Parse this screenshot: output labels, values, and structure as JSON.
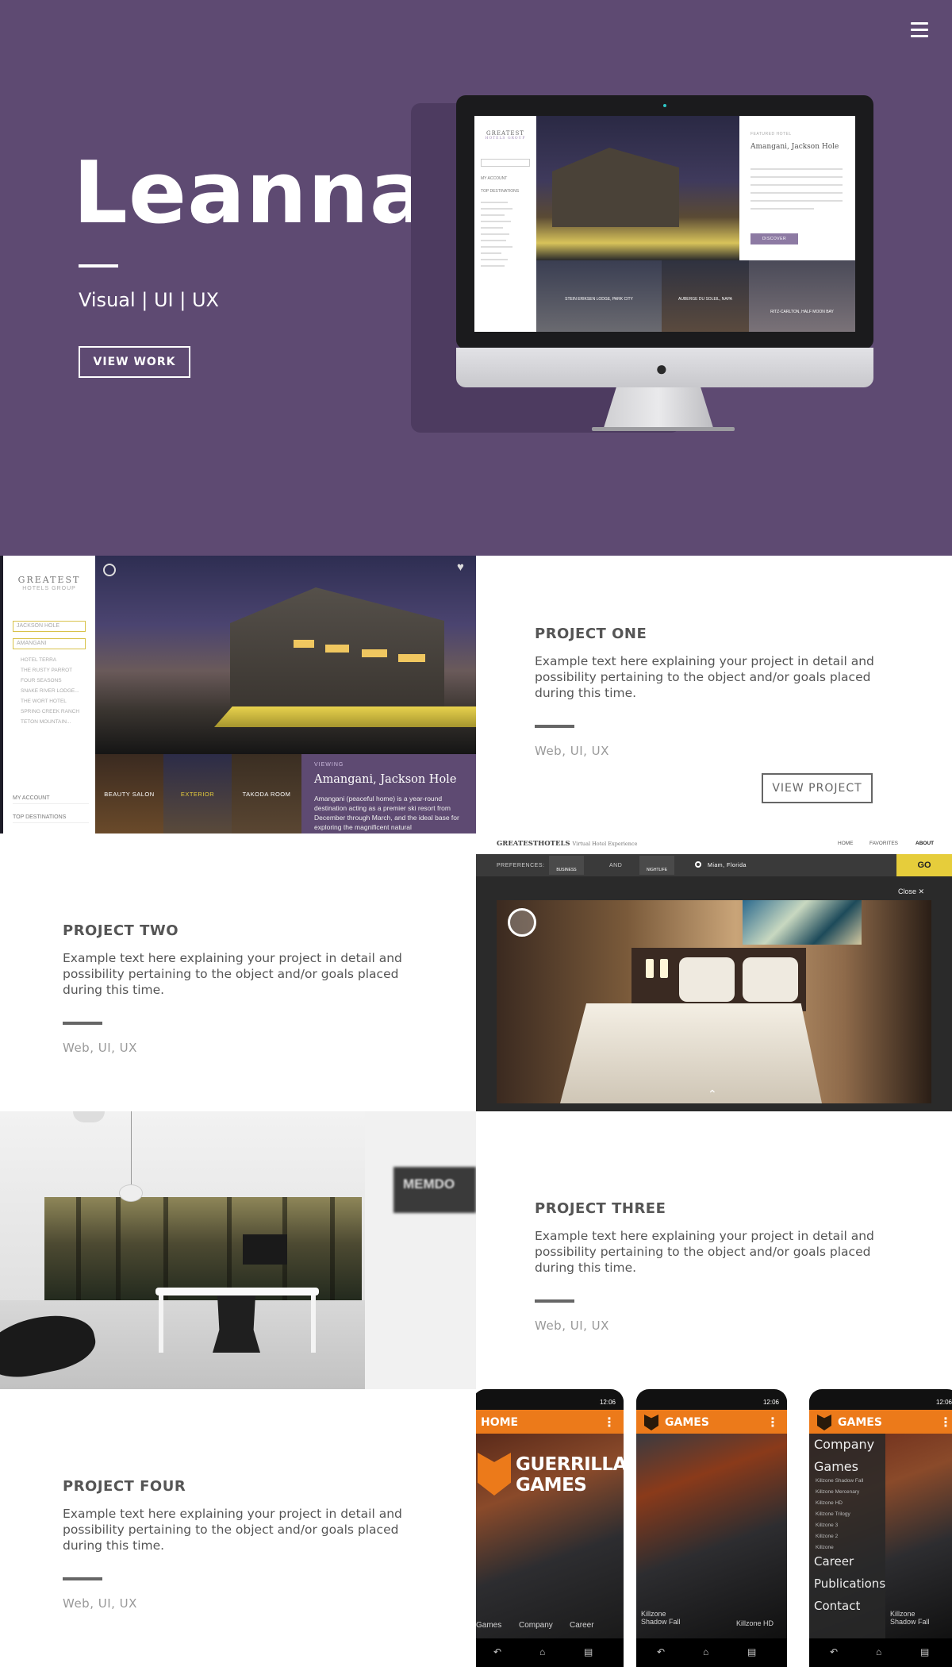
{
  "hero": {
    "title": "Leanna.",
    "subtitle": "Visual | UI | UX",
    "cta_label": "VIEW WORK",
    "menu_icon": "hamburger-menu-icon",
    "background_color": "#5e4a72"
  },
  "hero_mockup": {
    "brand_top": "GREATEST",
    "brand_bottom": "HOTELS GROUP",
    "featured_label": "FEATURED HOTEL",
    "featured_title": "Amangani, Jackson Hole",
    "discover_label": "DISCOVER",
    "sidebar_labels": [
      "MY ACCOUNT",
      "TOP DESTINATIONS"
    ],
    "thumbs": [
      "STEIN ERIKSEN LODGE, PARK CITY",
      "AUBERGE DU SOLEIL, NAPA",
      "RITZ-CARLTON, HALF MOON BAY"
    ]
  },
  "projects": [
    {
      "title": "PROJECT ONE",
      "description": "Example text here explaining your project in detail and possibility pertaining to the object and/or goals placed during this time.",
      "tags": "Web, UI, UX",
      "button_label": "VIEW PROJECT"
    },
    {
      "title": "PROJECT TWO",
      "description": "Example text here explaining your project in detail and possibility pertaining to the object and/or goals placed during this time.",
      "tags": "Web, UI, UX"
    },
    {
      "title": "PROJECT THREE",
      "description": "Example text here explaining your project in detail and possibility pertaining to the object and/or goals placed during this time.",
      "tags": "Web, UI, UX"
    },
    {
      "title": "PROJECT FOUR",
      "description": "Example text here explaining your project in detail and possibility pertaining to the object and/or goals placed during this time.",
      "tags": "Web, UI, UX"
    }
  ],
  "project_one_mockup": {
    "brand_top": "GREATEST",
    "brand_bottom": "HOTELS GROUP",
    "search_values": [
      "JACKSON HOLE",
      "AMANGANI"
    ],
    "hotel_list": [
      "HOTEL TERRA",
      "THE RUSTY PARROT",
      "FOUR SEASONS",
      "SNAKE RIVER LODGE...",
      "THE WORT HOTEL",
      "SPRING CREEK RANCH",
      "TETON MOUNTAIN..."
    ],
    "nav": [
      "MY ACCOUNT",
      "TOP DESTINATIONS"
    ],
    "thumbs": [
      "BEAUTY SALON",
      "EXTERIOR",
      "TAKODA ROOM"
    ],
    "viewing_label": "VIEWING",
    "hotel_name": "Amangani, Jackson Hole",
    "hotel_blurb": "Amangani (peaceful home) is a year-round destination acting as a premier ski resort from December through March, and the ideal base for exploring the magnificent natural"
  },
  "project_two_mockup": {
    "brand": "GREATESTHOTELS",
    "tagline": "Virtual Hotel Experience",
    "nav": [
      "HOME",
      "FAVORITES",
      "ABOUT"
    ],
    "preferences_label": "PREFERENCES:",
    "pref_one": "BUSINESS",
    "and_label": "AND",
    "pref_two": "NIGHTLIFE",
    "location": "Miam, Florida",
    "go_label": "GO",
    "close_label": "Close"
  },
  "project_three_mockup": {
    "sign_text": "MEMDO"
  },
  "project_four_mockup": {
    "status_time": "12:06",
    "screens": [
      {
        "title": "HOME",
        "logo_text": "GUERRILLA GAMES",
        "footer": [
          "Games",
          "Company",
          "Career"
        ]
      },
      {
        "title": "GAMES",
        "footer": [
          "Killzone Shadow Fall",
          "Killzone HD"
        ]
      },
      {
        "title": "GAMES",
        "menu": [
          "Company",
          "Games",
          "Career",
          "Publications",
          "Contact"
        ],
        "submenu": [
          "Killzone Shadow Fall",
          "Killzone Mercenary",
          "Killzone HD",
          "Killzone Trilogy",
          "Killzone 3",
          "Killzone 2",
          "Killzone"
        ],
        "footer": [
          "Killzone Shadow Fall"
        ]
      }
    ]
  }
}
